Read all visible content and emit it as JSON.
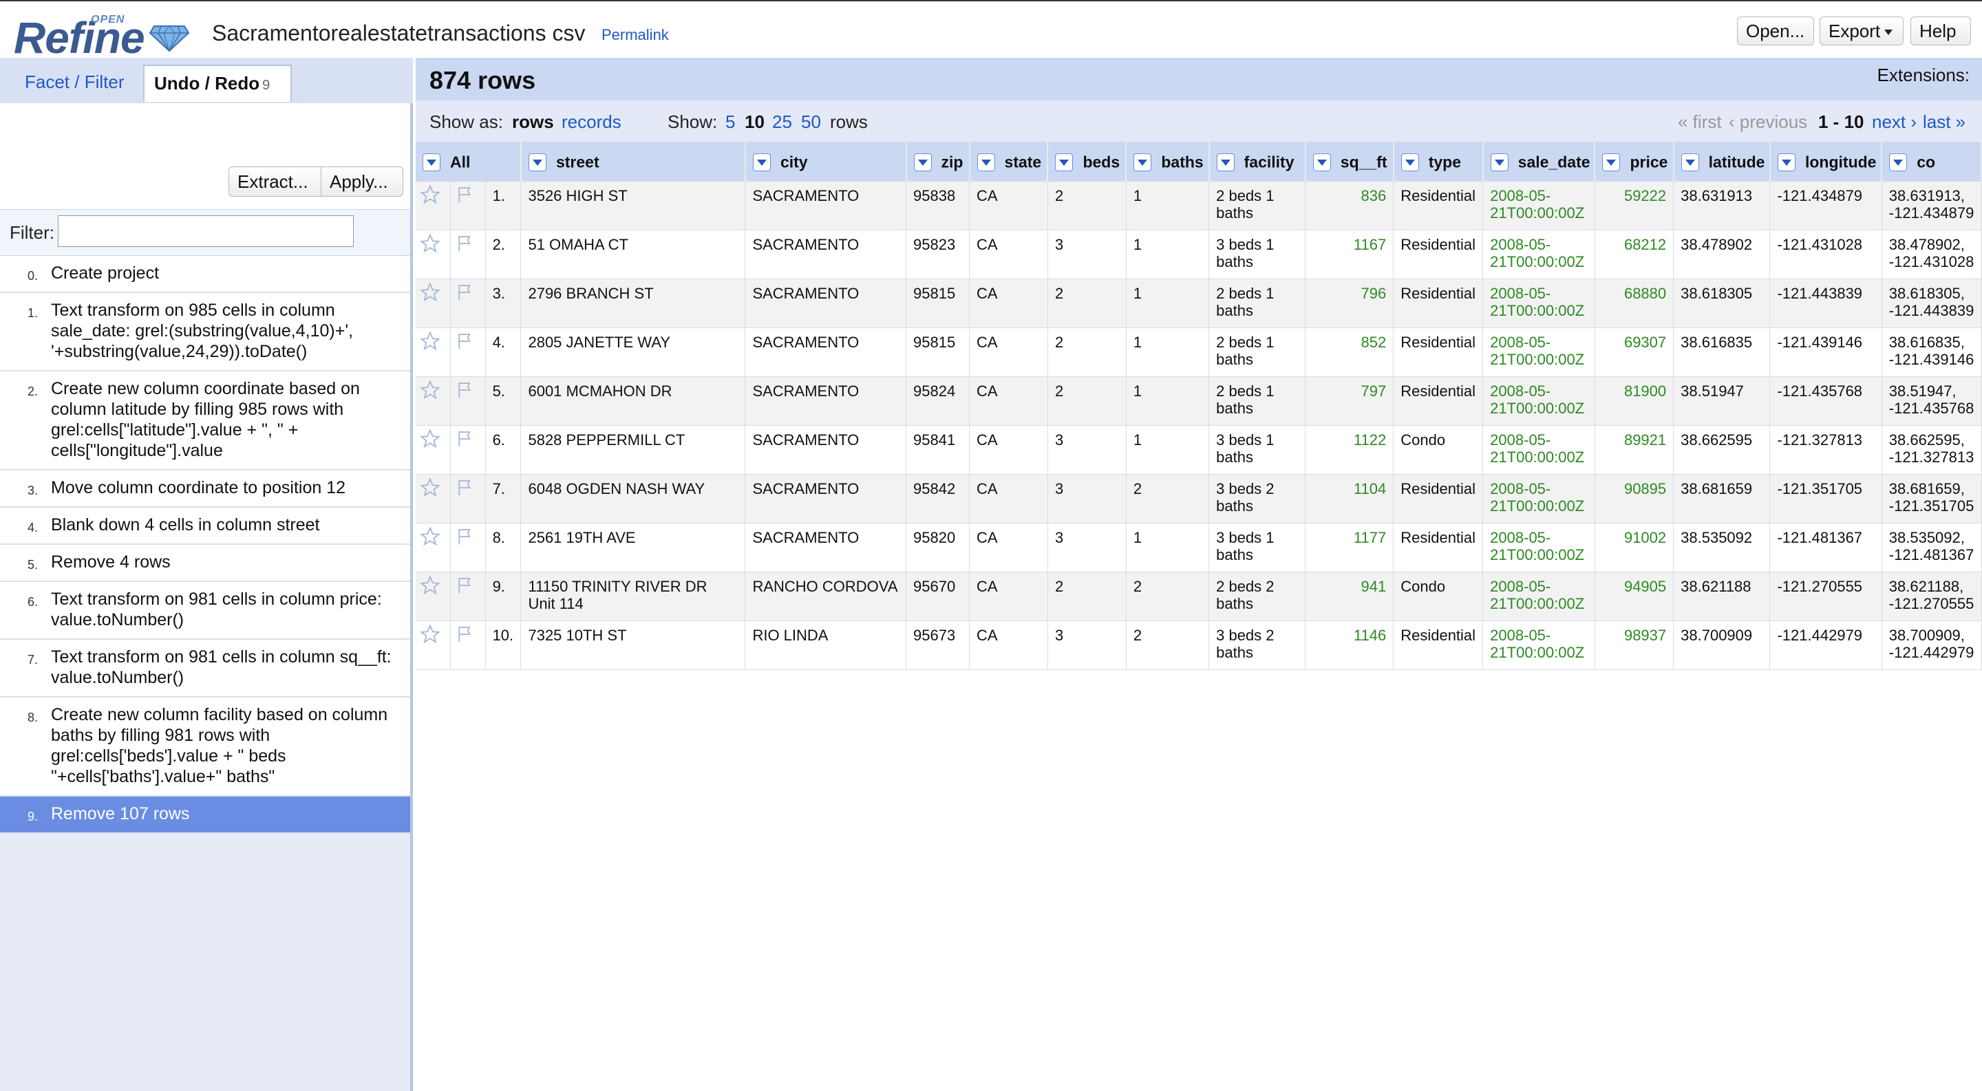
{
  "app": {
    "logo_text": "Refine",
    "logo_superscript": "OPEN"
  },
  "header": {
    "project_title": "Sacramentorealestatetransactions csv",
    "permalink": "Permalink",
    "open_label": "Open...",
    "export_label": "Export",
    "help_label": "Help"
  },
  "left_panel": {
    "tab_facet": "Facet / Filter",
    "tab_undo": "Undo / Redo",
    "undo_count": "9",
    "extract_label": "Extract...",
    "apply_label": "Apply...",
    "filter_label": "Filter:",
    "filter_value": "",
    "history": [
      {
        "num": "0.",
        "text": "Create project"
      },
      {
        "num": "1.",
        "text": "Text transform on 985 cells in column sale_date: grel:(substring(value,4,10)+', '+substring(value,24,29)).toDate()"
      },
      {
        "num": "2.",
        "text": "Create new column coordinate based on column latitude by filling 985 rows with grel:cells[\"latitude\"].value + \", \" + cells[\"longitude\"].value"
      },
      {
        "num": "3.",
        "text": "Move column coordinate to position 12"
      },
      {
        "num": "4.",
        "text": "Blank down 4 cells in column street"
      },
      {
        "num": "5.",
        "text": "Remove 4 rows"
      },
      {
        "num": "6.",
        "text": "Text transform on 981 cells in column price: value.toNumber()"
      },
      {
        "num": "7.",
        "text": "Text transform on 981 cells in column sq__ft: value.toNumber()"
      },
      {
        "num": "8.",
        "text": "Create new column facility based on column baths by filling 981 rows with grel:cells['beds'].value + \" beds \"+cells['baths'].value+\" baths\""
      },
      {
        "num": "9.",
        "text": "Remove 107 rows"
      }
    ]
  },
  "summary": {
    "row_count": "874 rows",
    "extensions": "Extensions:"
  },
  "view_bar": {
    "show_as": "Show as:",
    "rows_mode": "rows",
    "records_mode": "records",
    "show": "Show:",
    "page_sizes": [
      "5",
      "10",
      "25",
      "50"
    ],
    "rows_suffix": "rows",
    "first": "« first",
    "previous": "‹ previous",
    "range": "1 - 10",
    "next": "next ›",
    "last": "last »"
  },
  "table": {
    "columns": [
      "All",
      "street",
      "city",
      "zip",
      "state",
      "beds",
      "baths",
      "facility",
      "sq__ft",
      "type",
      "sale_date",
      "price",
      "latitude",
      "longitude",
      "co"
    ],
    "rows": [
      {
        "idx": "1.",
        "street": "3526 HIGH ST",
        "city": "SACRAMENTO",
        "zip": "95838",
        "state": "CA",
        "beds": "2",
        "baths": "1",
        "facility": "2 beds 1 baths",
        "sqft": "836",
        "type": "Residential",
        "sale_date": "2008-05-21T00:00:00Z",
        "price": "59222",
        "latitude": "38.631913",
        "longitude": "-121.434879",
        "coordinate": "38.631913, -121.434879"
      },
      {
        "idx": "2.",
        "street": "51 OMAHA CT",
        "city": "SACRAMENTO",
        "zip": "95823",
        "state": "CA",
        "beds": "3",
        "baths": "1",
        "facility": "3 beds 1 baths",
        "sqft": "1167",
        "type": "Residential",
        "sale_date": "2008-05-21T00:00:00Z",
        "price": "68212",
        "latitude": "38.478902",
        "longitude": "-121.431028",
        "coordinate": "38.478902, -121.431028"
      },
      {
        "idx": "3.",
        "street": "2796 BRANCH ST",
        "city": "SACRAMENTO",
        "zip": "95815",
        "state": "CA",
        "beds": "2",
        "baths": "1",
        "facility": "2 beds 1 baths",
        "sqft": "796",
        "type": "Residential",
        "sale_date": "2008-05-21T00:00:00Z",
        "price": "68880",
        "latitude": "38.618305",
        "longitude": "-121.443839",
        "coordinate": "38.618305, -121.443839"
      },
      {
        "idx": "4.",
        "street": "2805 JANETTE WAY",
        "city": "SACRAMENTO",
        "zip": "95815",
        "state": "CA",
        "beds": "2",
        "baths": "1",
        "facility": "2 beds 1 baths",
        "sqft": "852",
        "type": "Residential",
        "sale_date": "2008-05-21T00:00:00Z",
        "price": "69307",
        "latitude": "38.616835",
        "longitude": "-121.439146",
        "coordinate": "38.616835, -121.439146"
      },
      {
        "idx": "5.",
        "street": "6001 MCMAHON DR",
        "city": "SACRAMENTO",
        "zip": "95824",
        "state": "CA",
        "beds": "2",
        "baths": "1",
        "facility": "2 beds 1 baths",
        "sqft": "797",
        "type": "Residential",
        "sale_date": "2008-05-21T00:00:00Z",
        "price": "81900",
        "latitude": "38.51947",
        "longitude": "-121.435768",
        "coordinate": "38.51947, -121.435768"
      },
      {
        "idx": "6.",
        "street": "5828 PEPPERMILL CT",
        "city": "SACRAMENTO",
        "zip": "95841",
        "state": "CA",
        "beds": "3",
        "baths": "1",
        "facility": "3 beds 1 baths",
        "sqft": "1122",
        "type": "Condo",
        "sale_date": "2008-05-21T00:00:00Z",
        "price": "89921",
        "latitude": "38.662595",
        "longitude": "-121.327813",
        "coordinate": "38.662595, -121.327813"
      },
      {
        "idx": "7.",
        "street": "6048 OGDEN NASH WAY",
        "city": "SACRAMENTO",
        "zip": "95842",
        "state": "CA",
        "beds": "3",
        "baths": "2",
        "facility": "3 beds 2 baths",
        "sqft": "1104",
        "type": "Residential",
        "sale_date": "2008-05-21T00:00:00Z",
        "price": "90895",
        "latitude": "38.681659",
        "longitude": "-121.351705",
        "coordinate": "38.681659, -121.351705"
      },
      {
        "idx": "8.",
        "street": "2561 19TH AVE",
        "city": "SACRAMENTO",
        "zip": "95820",
        "state": "CA",
        "beds": "3",
        "baths": "1",
        "facility": "3 beds 1 baths",
        "sqft": "1177",
        "type": "Residential",
        "sale_date": "2008-05-21T00:00:00Z",
        "price": "91002",
        "latitude": "38.535092",
        "longitude": "-121.481367",
        "coordinate": "38.535092, -121.481367"
      },
      {
        "idx": "9.",
        "street": "11150 TRINITY RIVER DR Unit 114",
        "city": "RANCHO CORDOVA",
        "zip": "95670",
        "state": "CA",
        "beds": "2",
        "baths": "2",
        "facility": "2 beds 2 baths",
        "sqft": "941",
        "type": "Condo",
        "sale_date": "2008-05-21T00:00:00Z",
        "price": "94905",
        "latitude": "38.621188",
        "longitude": "-121.270555",
        "coordinate": "38.621188, -121.270555"
      },
      {
        "idx": "10.",
        "street": "7325 10TH ST",
        "city": "RIO LINDA",
        "zip": "95673",
        "state": "CA",
        "beds": "3",
        "baths": "2",
        "facility": "3 beds 2 baths",
        "sqft": "1146",
        "type": "Residential",
        "sale_date": "2008-05-21T00:00:00Z",
        "price": "98937",
        "latitude": "38.700909",
        "longitude": "-121.442979",
        "coordinate": "38.700909, -121.442979"
      }
    ]
  }
}
